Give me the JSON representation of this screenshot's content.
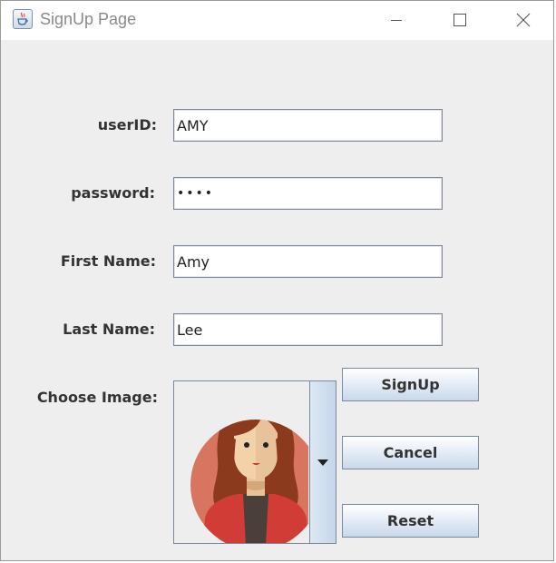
{
  "window": {
    "title": "SignUp Page"
  },
  "form": {
    "userid_label": "userID:",
    "userid_value": "AMY",
    "password_label": "password:",
    "password_value": "••••",
    "firstname_label": "First Name:",
    "firstname_value": "Amy",
    "lastname_label": "Last Name:",
    "lastname_value": "Lee",
    "image_label": "Choose Image:"
  },
  "buttons": {
    "signup": "SignUp",
    "cancel": "Cancel",
    "reset": "Reset"
  },
  "icons": {
    "app": "java-coffee-cup-icon",
    "minimize": "minimize-icon",
    "maximize": "maximize-icon",
    "close": "close-icon",
    "dropdown": "chevron-down-icon",
    "avatar": "female-avatar-image"
  }
}
